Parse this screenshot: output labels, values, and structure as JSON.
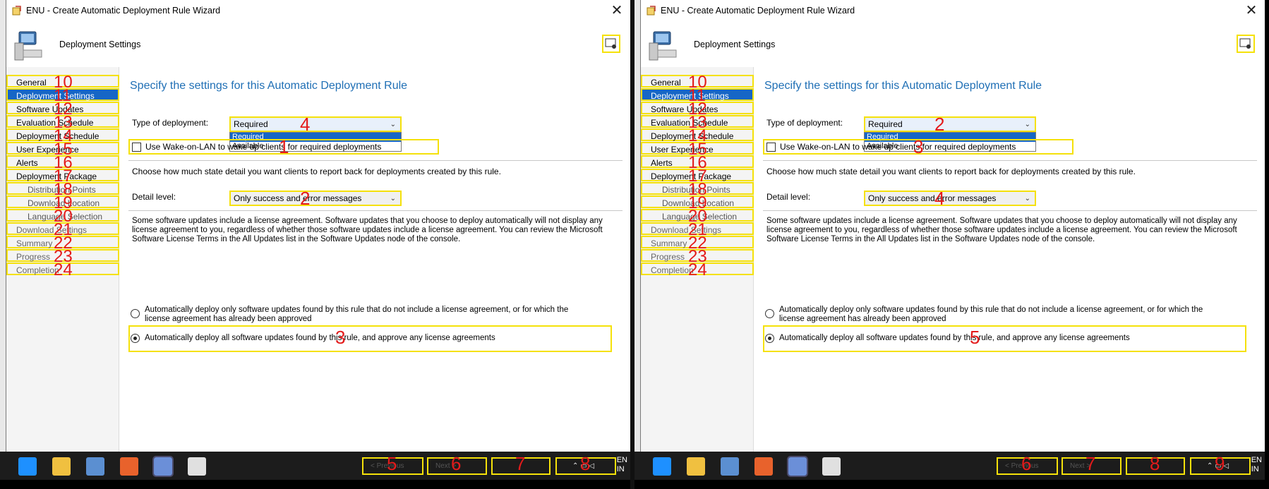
{
  "panels": [
    {
      "title": "ENU - Create Automatic Deployment Rule Wizard",
      "header_title": "Deployment Settings",
      "nav": [
        {
          "label": "General",
          "badge": "10"
        },
        {
          "label": "Deployment Settings",
          "badge": "11"
        },
        {
          "label": "Software Updates",
          "badge": "12"
        },
        {
          "label": "Evaluation Schedule",
          "badge": "13"
        },
        {
          "label": "Deployment Schedule",
          "badge": "14"
        },
        {
          "label": "User Experience",
          "badge": "15"
        },
        {
          "label": "Alerts",
          "badge": "16"
        },
        {
          "label": "Deployment Package",
          "badge": "17"
        },
        {
          "label": "Distribution Points",
          "badge": "18"
        },
        {
          "label": "Download Location",
          "badge": "19"
        },
        {
          "label": "Language Selection",
          "badge": "20"
        },
        {
          "label": "Download Settings",
          "badge": "21"
        },
        {
          "label": "Summary",
          "badge": "22"
        },
        {
          "label": "Progress",
          "badge": "23"
        },
        {
          "label": "Completion",
          "badge": "24"
        }
      ],
      "content": {
        "heading": "Specify the settings for this Automatic Deployment Rule",
        "type_label": "Type of deployment:",
        "type_value": "Required",
        "type_badge": "4",
        "dropdown_options": [
          "Required",
          "Available"
        ],
        "wol_label": "Use Wake-on-LAN to wake up clients for required deployments",
        "wol_badge": "1",
        "state_detail_text": "Choose how much state detail you want clients to report back for deployments created by this rule.",
        "detail_label": "Detail level:",
        "detail_value": "Only success and error messages",
        "detail_badge": "2",
        "license_text": "Some software updates include a license agreement. Software updates that you choose to deploy automatically will not display any license agreement to you, regardless of whether those software updates include a license agreement. You can review the Microsoft Software License Terms in the All Updates list in the Software Updates node of the console.",
        "radio1_label": "Automatically deploy only software updates found by this rule that do not include a license agreement, or for which the license agreement has already been approved",
        "radio2_label": "Automatically deploy all software updates found by this rule, and approve any license agreements",
        "radio2_badge": "3"
      },
      "taskbar": {
        "prev_label": "< Previous",
        "next_label": "Next >",
        "badges": [
          "5",
          "6",
          "7",
          "8"
        ],
        "lang": [
          "EN",
          "IN"
        ]
      }
    },
    {
      "title": "ENU - Create Automatic Deployment Rule Wizard",
      "header_title": "Deployment Settings",
      "nav": [
        {
          "label": "General",
          "badge": "10"
        },
        {
          "label": "Deployment Settings",
          "badge": "11"
        },
        {
          "label": "Software Updates",
          "badge": "12"
        },
        {
          "label": "Evaluation Schedule",
          "badge": "13"
        },
        {
          "label": "Deployment Schedule",
          "badge": "14"
        },
        {
          "label": "User Experience",
          "badge": "15"
        },
        {
          "label": "Alerts",
          "badge": "16"
        },
        {
          "label": "Deployment Package",
          "badge": "17"
        },
        {
          "label": "Distribution Points",
          "badge": "18"
        },
        {
          "label": "Download Location",
          "badge": "19"
        },
        {
          "label": "Language Selection",
          "badge": "20"
        },
        {
          "label": "Download Settings",
          "badge": "21"
        },
        {
          "label": "Summary",
          "badge": "22"
        },
        {
          "label": "Progress",
          "badge": "23"
        },
        {
          "label": "Completion",
          "badge": "24"
        }
      ],
      "content": {
        "heading": "Specify the settings for this Automatic Deployment Rule",
        "type_label": "Type of deployment:",
        "type_value": "Required",
        "type_badge": "2",
        "dropdown_options": [
          "Required",
          "Available"
        ],
        "wol_label": "Use Wake-on-LAN to wake up clients for required deployments",
        "wol_badge": "3",
        "state_detail_text": "Choose how much state detail you want clients to report back for deployments created by this rule.",
        "detail_label": "Detail level:",
        "detail_value": "Only success and error messages",
        "detail_badge": "4",
        "license_text": "Some software updates include a license agreement. Software updates that you choose to deploy automatically will not display any license agreement to you, regardless of whether those software updates include a license agreement. You can review the Microsoft Software License Terms in the All Updates list in the Software Updates node of the console.",
        "radio1_label": "Automatically deploy only software updates found by this rule that do not include a license agreement, or for which the license agreement has already been approved",
        "radio2_label": "Automatically deploy all software updates found by this rule, and approve any license agreements",
        "radio2_badge": "5"
      },
      "taskbar": {
        "prev_label": "< Previous",
        "next_label": "Next >",
        "badges": [
          "6",
          "7",
          "8",
          "9"
        ],
        "lang": [
          "EN",
          "IN"
        ]
      }
    }
  ],
  "colors": {
    "accent": "#1666c6",
    "highlight": "#f5e10a",
    "badge": "#e31b1b",
    "heading": "#1f6fb5",
    "taskbar": "#1c1c1c"
  },
  "icons": {
    "title": "wizard-icon",
    "header": "computer-icon",
    "help": "help-icon",
    "close": "close-icon",
    "taskbar": [
      "internet-explorer-icon",
      "file-explorer-icon",
      "server-manager-icon",
      "ubuntu-icon",
      "config-manager-icon",
      "document-icon"
    ]
  }
}
